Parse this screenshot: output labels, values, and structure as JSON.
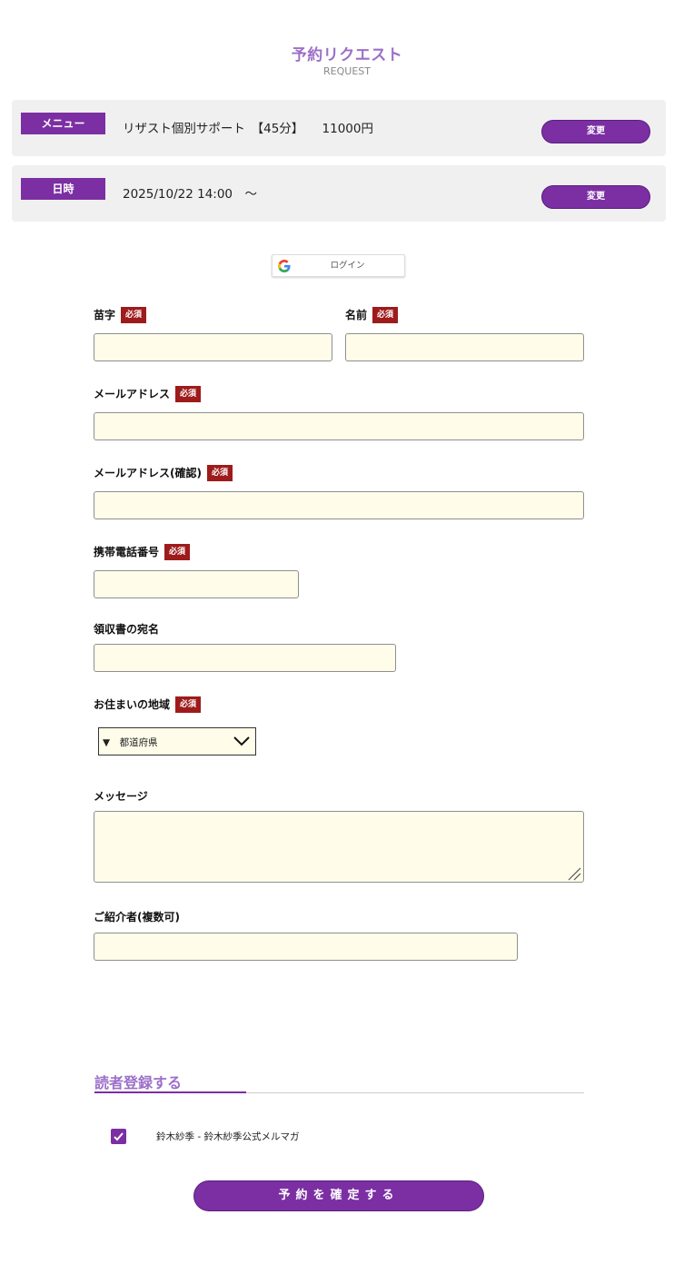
{
  "header": {
    "title": "予約リクエスト",
    "subtitle": "REQUEST"
  },
  "menu_box": {
    "tag": "メニュー",
    "text": "リザスト個別サポート　【45分】　　11000円",
    "change_label": "変更"
  },
  "date_box": {
    "tag": "日時",
    "text": "2025/10/22 14:00　〜",
    "change_label": "変更"
  },
  "google": {
    "label": "ログイン"
  },
  "required_label": "必須",
  "form": {
    "last_name": {
      "label": "苗字",
      "value": ""
    },
    "first_name": {
      "label": "名前",
      "value": ""
    },
    "email": {
      "label": "メールアドレス",
      "value": ""
    },
    "email_confirm": {
      "label": "メールアドレス(確認)",
      "value": ""
    },
    "phone": {
      "label": "携帯電話番号",
      "value": ""
    },
    "receipt_name": {
      "label": "領収書の宛名",
      "value": ""
    },
    "region": {
      "label": "お住まいの地域",
      "selected": "▼　都道府県"
    },
    "message": {
      "label": "メッセージ",
      "value": ""
    },
    "referrer": {
      "label": "ご紹介者(複数可)",
      "value": ""
    }
  },
  "newsletter": {
    "title": "読者登録する",
    "item_label": "鈴木紗季 - 鈴木紗季公式メルマガ",
    "checked": true
  },
  "submit_label": "予約を確定する",
  "colors": {
    "accent": "#7b2fa3",
    "title": "#9c6fc9",
    "required": "#9e1b1b",
    "input_bg": "#fffdea"
  }
}
